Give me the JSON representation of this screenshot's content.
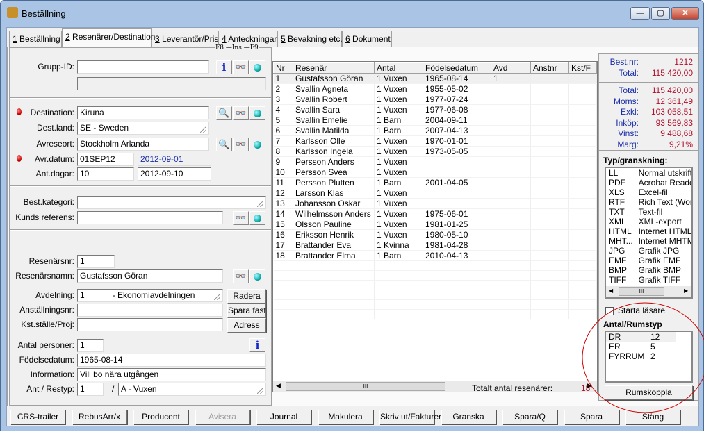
{
  "window": {
    "title": "Beställning",
    "min": "—",
    "max": "▢",
    "close": "✕"
  },
  "tabs": [
    {
      "key": "1",
      "label": " Beställning"
    },
    {
      "key": "2",
      "label": " Resenärer/Destination"
    },
    {
      "key": "3",
      "label": " Leverantör/Pris"
    },
    {
      "key": "4",
      "label": " Anteckningar"
    },
    {
      "key": "5",
      "label": " Bevakning etc."
    },
    {
      "key": "6",
      "label": " Dokument"
    }
  ],
  "shortcuts": {
    "f8": "F8",
    "ins": "Ins",
    "f9": "F9"
  },
  "form": {
    "grupp_id": {
      "label": "Grupp-ID:",
      "value": "",
      "extra": ""
    },
    "destination": {
      "label": "Destination:",
      "value": "Kiruna"
    },
    "dest_land": {
      "label": "Dest.land:",
      "value": "SE  - Sweden"
    },
    "avreseort": {
      "label": "Avreseort:",
      "value": "Stockholm Arlanda"
    },
    "avr_datum": {
      "label": "Avr.datum:",
      "value": "01SEP12",
      "date": "2012-09-01"
    },
    "ant_dagar": {
      "label": "Ant.dagar:",
      "value": "10",
      "date": "2012-09-10"
    },
    "best_kategori": {
      "label": "Best.kategori:",
      "value": ""
    },
    "kunds_referens": {
      "label": "Kunds referens:",
      "value": ""
    },
    "resenarsnr": {
      "label": "Resenärsnr:",
      "value": "1"
    },
    "resenarsnamn": {
      "label": "Resenärsnamn:",
      "value": "Gustafsson Göran"
    },
    "avdelning": {
      "label": "Avdelning:",
      "value": "1            - Ekonomiavdelningen"
    },
    "anstallningsnr": {
      "label": "Anställningsnr:",
      "value": ""
    },
    "kst": {
      "label": "Kst.ställe/Proj:",
      "value": ""
    },
    "antal_personer": {
      "label": "Antal personer:",
      "value": "1"
    },
    "fodelsedatum": {
      "label": "Födelsedatum:",
      "value": "1965-08-14"
    },
    "information": {
      "label": "Information:",
      "value": "Vill bo nära utgången"
    },
    "ant_restyp": {
      "label": "Ant / Restyp:",
      "value": "1",
      "slash": "/",
      "type": "A  - Vuxen"
    },
    "buttons": {
      "radera": "Radera",
      "spara_fast": "Spara fast",
      "adress": "Adress"
    }
  },
  "grid": {
    "columns": [
      "Nr",
      "Resenär",
      "Antal",
      "Födelsedatum",
      "Avd",
      "Anstnr",
      "Kst/F"
    ],
    "rows": [
      [
        "1",
        "Gustafsson Göran",
        "1 Vuxen",
        "1965-08-14",
        "1"
      ],
      [
        "2",
        "Svallin Agneta",
        "1 Vuxen",
        "1955-05-02",
        ""
      ],
      [
        "3",
        "Svallin Robert",
        "1 Vuxen",
        "1977-07-24",
        ""
      ],
      [
        "4",
        "Svallin Sara",
        "1 Vuxen",
        "1977-06-08",
        ""
      ],
      [
        "5",
        "Svallin Emelie",
        "1 Barn",
        "2004-09-11",
        ""
      ],
      [
        "6",
        "Svallin Matilda",
        "1 Barn",
        "2007-04-13",
        ""
      ],
      [
        "7",
        "Karlsson Olle",
        "1 Vuxen",
        "1970-01-01",
        ""
      ],
      [
        "8",
        "Karlsson Ingela",
        "1 Vuxen",
        "1973-05-05",
        ""
      ],
      [
        "9",
        "Persson Anders",
        "1 Vuxen",
        "",
        ""
      ],
      [
        "10",
        "Persson Svea",
        "1 Vuxen",
        "",
        ""
      ],
      [
        "11",
        "Persson Plutten",
        "1 Barn",
        "2001-04-05",
        ""
      ],
      [
        "12",
        "Larsson Klas",
        "1 Vuxen",
        "",
        ""
      ],
      [
        "13",
        "Johansson Oskar",
        "1 Vuxen",
        "",
        ""
      ],
      [
        "14",
        "Wilhelmsson Anders",
        "1 Vuxen",
        "1975-06-01",
        ""
      ],
      [
        "15",
        "Olsson Pauline",
        "1 Vuxen",
        "1981-01-25",
        ""
      ],
      [
        "16",
        "Eriksson Henrik",
        "1 Vuxen",
        "1980-05-10",
        ""
      ],
      [
        "17",
        "Brattander Eva",
        "1 Kvinna",
        "1981-04-28",
        ""
      ],
      [
        "18",
        "Brattander Elma",
        "1 Barn",
        "2010-04-13",
        ""
      ]
    ],
    "total_label": "Totalt antal resenärer:",
    "total_value": "18"
  },
  "summary": {
    "top": [
      {
        "label": "Best.nr:",
        "value": "1212"
      },
      {
        "label": "Total:",
        "value": "115 420,00"
      }
    ],
    "bottom": [
      {
        "label": "Total:",
        "value": "115 420,00"
      },
      {
        "label": "Moms:",
        "value": "12 361,49"
      },
      {
        "label": "Exkl:",
        "value": "103 058,51"
      },
      {
        "label": "Inköp:",
        "value": "93 569,83"
      },
      {
        "label": "Vinst:",
        "value": "9 488,68"
      },
      {
        "label": "Marg:",
        "value": "9,21%"
      }
    ]
  },
  "typ": {
    "title": "Typ/granskning:",
    "items": [
      [
        "LL",
        "Normal utskrift"
      ],
      [
        "PDF",
        "Acrobat Reader"
      ],
      [
        "XLS",
        "Excel-fil"
      ],
      [
        "RTF",
        "Rich Text (Word)"
      ],
      [
        "TXT",
        "Text-fil"
      ],
      [
        "XML",
        "XML-export"
      ],
      [
        "HTML",
        "Internet HTML"
      ],
      [
        "MHT...",
        "Internet MHTML"
      ],
      [
        "JPG",
        "Grafik JPG"
      ],
      [
        "EMF",
        "Grafik EMF"
      ],
      [
        "BMP",
        "Grafik BMP"
      ],
      [
        "TIFF",
        "Grafik TIFF"
      ]
    ]
  },
  "starta_lasare": {
    "label": "Starta läsare",
    "checked": false
  },
  "rumstyp": {
    "title": "Antal/Rumstyp",
    "items": [
      [
        "DR",
        "12"
      ],
      [
        "ER",
        "5"
      ],
      [
        "FYRRUM",
        "2"
      ]
    ],
    "button": "Rumskoppla"
  },
  "footer": [
    "CRS-trailer",
    "RebusArr/x",
    "Producent",
    "Avisera",
    "Journal",
    "Makulera",
    "Skriv ut/Fakturera",
    "Granska",
    "Spara/Q",
    "Spara",
    "Stäng"
  ],
  "colors": {
    "label_blue": "#1a2ea8",
    "value_red": "#b0102a",
    "annotation": "#cc0000"
  }
}
